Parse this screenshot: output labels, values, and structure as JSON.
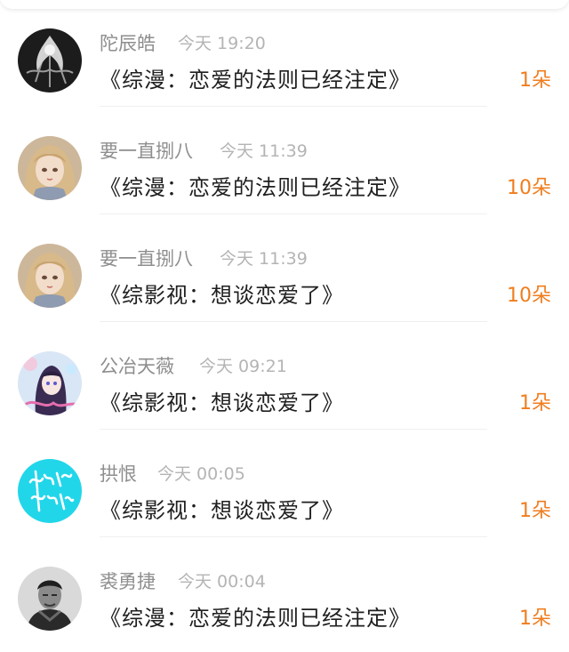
{
  "colors": {
    "name": "#8e8e8e",
    "time": "#b4b4b4",
    "title": "#1f1f1f",
    "count": "#f07d1e",
    "divider": "#efefef"
  },
  "entries": [
    {
      "name": "陀辰皓",
      "time": "今天 19:20",
      "title": "《综漫：恋爱的法则已经注定》",
      "count": "1朵",
      "avatar_icon": "dark-feather-avatar"
    },
    {
      "name": "要一直捌八",
      "time": "今天 11:39",
      "title": "《综漫：恋爱的法则已经注定》",
      "count": "10朵",
      "avatar_icon": "blonde-girl-avatar"
    },
    {
      "name": "要一直捌八",
      "time": "今天 11:39",
      "title": "《综影视：想谈恋爱了》",
      "count": "10朵",
      "avatar_icon": "blonde-girl-avatar"
    },
    {
      "name": "公冶天薇",
      "time": "今天 09:21",
      "title": "《综影视：想谈恋爱了》",
      "count": "1朵",
      "avatar_icon": "anime-girl-avatar"
    },
    {
      "name": "拱恨",
      "time": "今天 00:05",
      "title": "《综影视：想谈恋爱了》",
      "count": "1朵",
      "avatar_icon": "cyan-calligraphy-avatar"
    },
    {
      "name": "裘勇捷",
      "time": "今天 00:04",
      "title": "《综漫：恋爱的法则已经注定》",
      "count": "1朵",
      "avatar_icon": "man-portrait-avatar"
    }
  ]
}
